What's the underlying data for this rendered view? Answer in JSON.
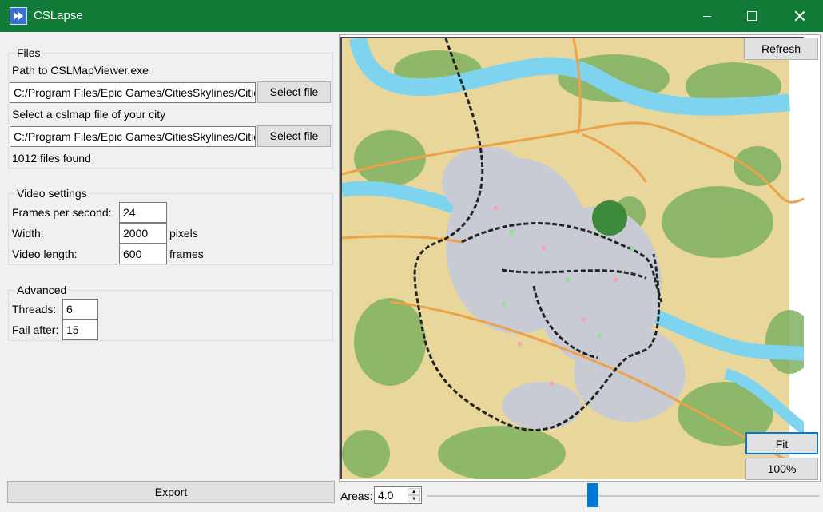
{
  "window": {
    "title": "CSLapse"
  },
  "files": {
    "group_title": "Files",
    "exe_label": "Path to CSLMapViewer.exe",
    "exe_path": "C:/Program Files/Epic Games/CitiesSkylines/Cities_Data/",
    "exe_button": "Select file",
    "map_label": "Select a cslmap file of your city",
    "map_path": "C:/Program Files/Epic Games/CitiesSkylines/Cities_Data/",
    "map_button": "Select file",
    "status": "1012 files found"
  },
  "video": {
    "group_title": "Video settings",
    "fps_label": "Frames per second:",
    "fps_value": "24",
    "width_label": "Width:",
    "width_value": "2000",
    "width_unit": "pixels",
    "length_label": "Video length:",
    "length_value": "600",
    "length_unit": "frames"
  },
  "advanced": {
    "group_title": "Advanced",
    "threads_label": "Threads:",
    "threads_value": "6",
    "fail_label": "Fail after:",
    "fail_value": "15"
  },
  "actions": {
    "export": "Export",
    "refresh": "Refresh",
    "fit": "Fit",
    "zoom100": "100%"
  },
  "areas": {
    "label": "Areas:",
    "value": "4.0",
    "slider_fraction": 0.42
  },
  "colors": {
    "titlebar": "#117a36",
    "sand": "#e9d69a",
    "water": "#7ed3ef",
    "forest": "#6fa85a",
    "road": "#eba248",
    "city": "#c9cbd4",
    "slider": "#0078d7"
  }
}
